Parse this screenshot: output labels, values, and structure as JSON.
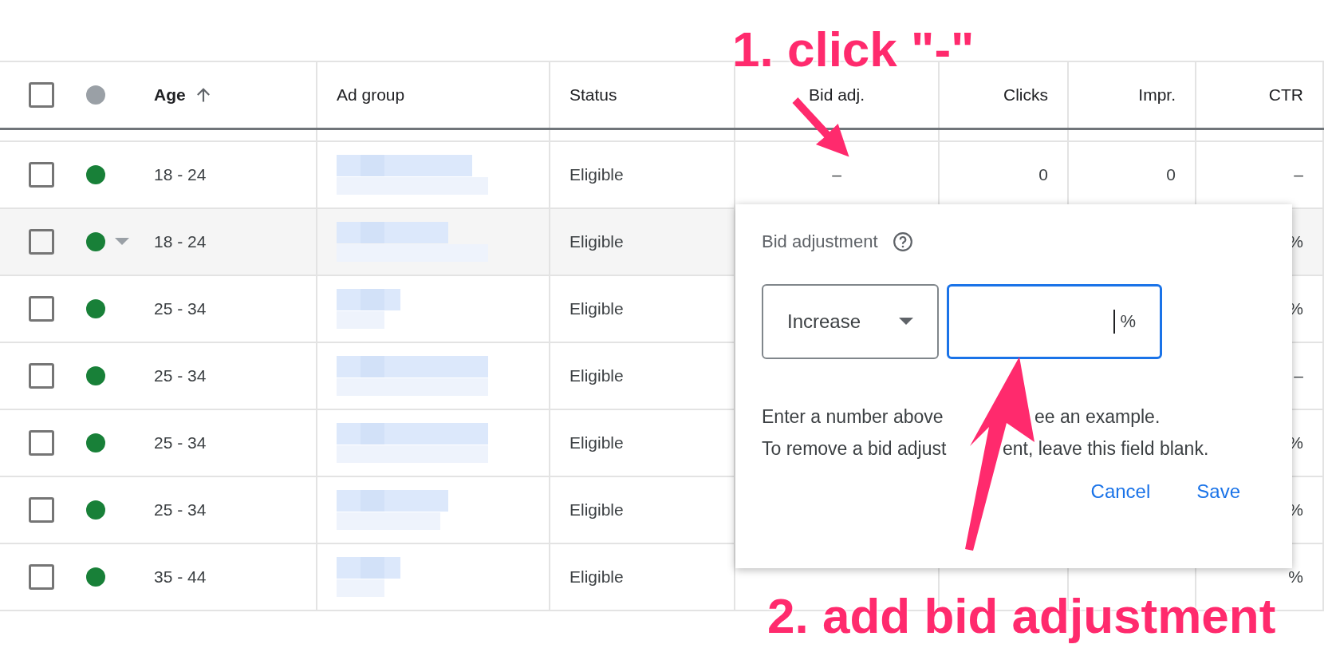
{
  "table": {
    "select_all": {
      "checked": false
    },
    "status_header": {
      "color": "#9aa0a6"
    },
    "columns": [
      {
        "label": "Age",
        "sorted": true
      },
      {
        "label": "Ad group",
        "sorted": false
      },
      {
        "label": "Status",
        "sorted": false
      },
      {
        "label": "Bid adj.",
        "sorted": false
      },
      {
        "label": "Clicks",
        "sorted": false
      },
      {
        "label": "Impr.",
        "sorted": false
      },
      {
        "label": "CTR",
        "sorted": false
      }
    ],
    "rows": [
      {
        "checked": false,
        "color": "#188038",
        "highlighted": false,
        "menu": false,
        "age": "18 - 24",
        "ad_group": {
          "kind": "blurred"
        },
        "status": "Eligible",
        "bid_adj": "–",
        "clicks": "0",
        "impr": "0",
        "ctr": "–"
      },
      {
        "checked": false,
        "color": "#188038",
        "highlighted": true,
        "menu": true,
        "age": "18 - 24",
        "ad_group": {
          "kind": "blurred"
        },
        "status": "Eligible",
        "ctr": "%"
      },
      {
        "checked": false,
        "color": "#188038",
        "highlighted": false,
        "menu": false,
        "age": "25 - 34",
        "ad_group": {
          "kind": "blurred"
        },
        "status": "Eligible",
        "ctr": "%"
      },
      {
        "checked": false,
        "color": "#188038",
        "highlighted": false,
        "menu": false,
        "age": "25 - 34",
        "ad_group": {
          "kind": "blurred"
        },
        "status": "Eligible",
        "ctr": "–"
      },
      {
        "checked": false,
        "color": "#188038",
        "highlighted": false,
        "menu": false,
        "age": "25 - 34",
        "ad_group": {
          "kind": "blurred"
        },
        "status": "Eligible",
        "ctr": "%"
      },
      {
        "checked": false,
        "color": "#188038",
        "highlighted": false,
        "menu": false,
        "age": "25 - 34",
        "ad_group": {
          "kind": "blurred"
        },
        "status": "Eligible",
        "ctr": "%"
      },
      {
        "checked": false,
        "color": "#188038",
        "highlighted": false,
        "menu": false,
        "age": "35 - 44",
        "ad_group": {
          "kind": "blurred"
        },
        "status": "Eligible",
        "ctr": "%"
      }
    ]
  },
  "popup": {
    "title": "Bid adjustment",
    "direction": "Increase",
    "input": {
      "focused": true,
      "suffix": "%"
    },
    "help": [
      {
        "parts": [
          "Enter a number above",
          "ee an example."
        ]
      },
      {
        "parts": [
          "To remove a bid adjust",
          "ent, leave this field blank."
        ]
      }
    ],
    "buttons": [
      "Cancel",
      "Save"
    ]
  },
  "annotations": [
    {
      "text": "1. click \"-\""
    },
    {
      "text": "2. add bid adjustment"
    }
  ]
}
